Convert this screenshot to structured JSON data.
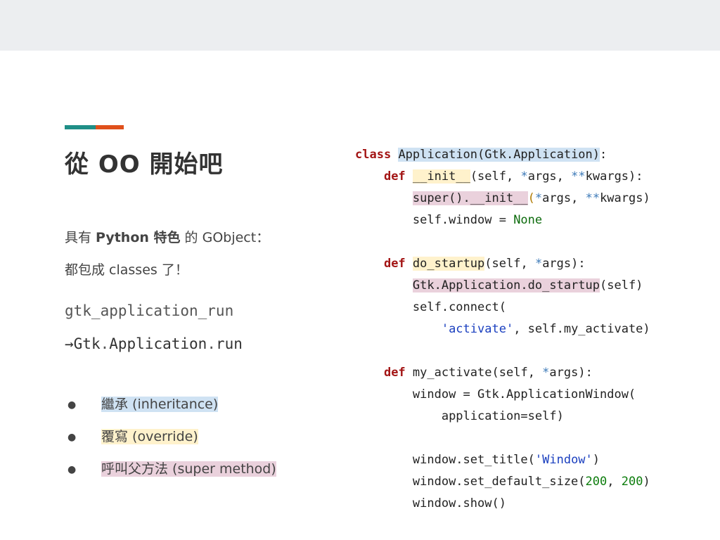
{
  "colors": {
    "accent_teal": "#1f8f87",
    "accent_orange": "#e0501b",
    "highlight_inheritance": "#cfe2f3",
    "highlight_override": "#fff2cc",
    "highlight_super": "#ead1dc"
  },
  "slide": {
    "title": "從 OO 開始吧",
    "desc_line1": {
      "prefix": "具有 ",
      "bold": "Python 特色",
      "suffix": " 的 GObject："
    },
    "desc_line2": "都包成 classes 了！",
    "old_name": "gtk_application_run",
    "arrow": "→",
    "new_name_parts": [
      "Gtk",
      ".",
      "Application",
      ".",
      "run"
    ],
    "bullets": [
      {
        "label": "繼承 (inheritance)"
      },
      {
        "label": "覆寫 (override)"
      },
      {
        "label": "呼叫父方法 (super method)"
      }
    ],
    "bullet_glyph": "●"
  },
  "code": {
    "kw_class": "class",
    "class_decl": "Application(Gtk.Application)",
    "colon": ":",
    "kw_def": "def",
    "init_name": "__init__",
    "init_params_a": "(self, ",
    "star": "*",
    "args": "args, ",
    "dstar": "**",
    "kwargs": "kwargs",
    "close_colon": "):",
    "super_call": "super().__init__",
    "super_args_a": "(",
    "super_args_b": "args, ",
    "super_args_c": "kwargs)",
    "window_none_a": "self.window = ",
    "none": "None",
    "startup_name": "do_startup",
    "startup_params_a": "(self, ",
    "startup_params_b": "args):",
    "parent_startup": "Gtk.Application.do_startup",
    "parent_startup_args": "(self)",
    "connect_line": "self.connect(",
    "activate_str": "'activate'",
    "connect_args": ", self.my_activate)",
    "my_activate_name": "my_activate",
    "my_activate_params_a": "(self, ",
    "my_activate_params_b": "args):",
    "window_assign": "window = Gtk.ApplicationWindow(",
    "app_arg": "application=self)",
    "set_title_a": "window.set_title(",
    "window_str": "'Window'",
    "set_title_b": ")",
    "set_size_a": "window.set_default_size(",
    "size_w": "200",
    "size_sep": ", ",
    "size_h": "200",
    "set_size_b": ")",
    "show_line": "window.show()"
  }
}
